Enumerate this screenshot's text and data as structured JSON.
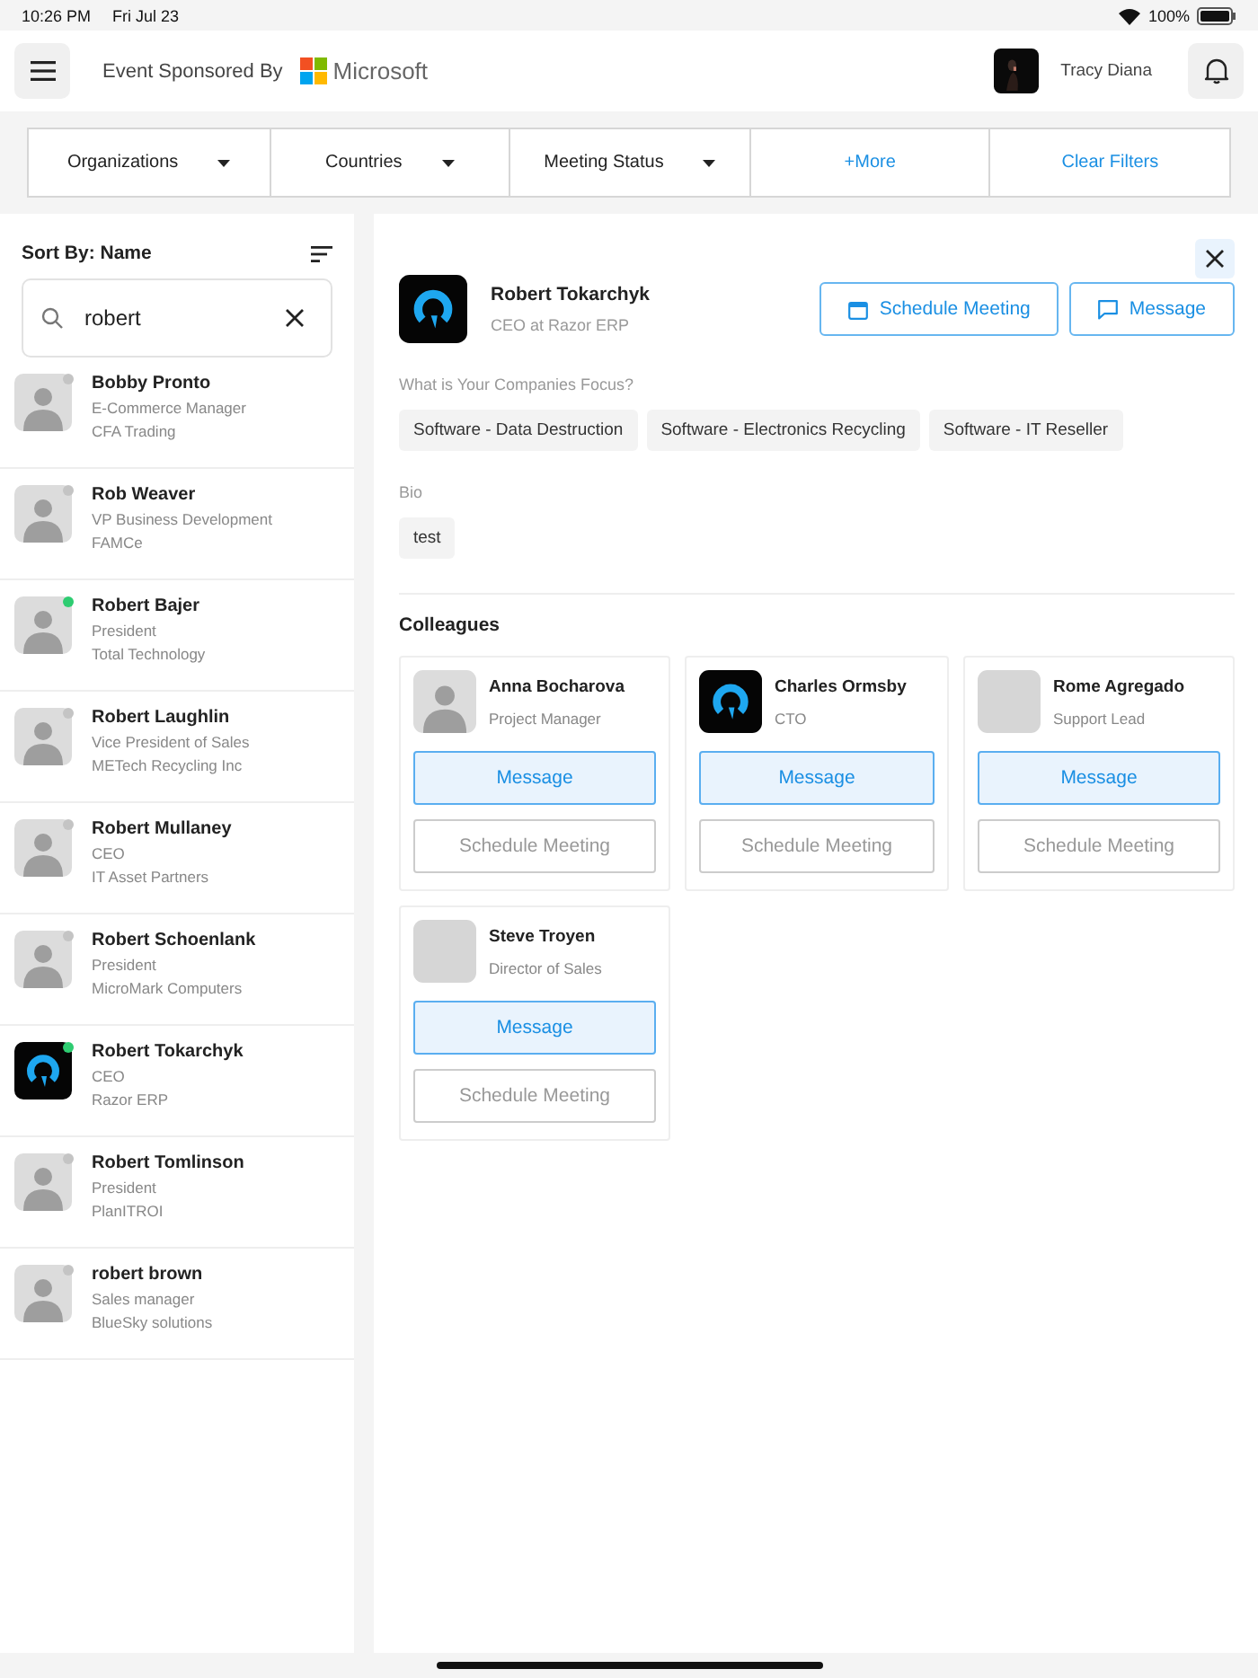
{
  "status_bar": {
    "time": "10:26 PM",
    "date": "Fri Jul 23",
    "battery": "100%"
  },
  "header": {
    "sponsor_label": "Event Sponsored By",
    "sponsor_name": "Microsoft",
    "user_name": "Tracy Diana"
  },
  "filters": [
    {
      "label": "Organizations",
      "kind": "dropdown"
    },
    {
      "label": "Countries",
      "kind": "dropdown"
    },
    {
      "label": "Meeting Status",
      "kind": "dropdown"
    },
    {
      "label": "+More",
      "kind": "link"
    },
    {
      "label": "Clear Filters",
      "kind": "link"
    }
  ],
  "sidebar": {
    "sort_label": "Sort By: Name",
    "search": {
      "value": "robert"
    },
    "people": [
      {
        "name": "Bobby Pronto",
        "title": "E-Commerce Manager",
        "company": "CFA Trading",
        "avatar": {
          "kind": "placeholder"
        },
        "online": false
      },
      {
        "name": "Rob Weaver",
        "title": "VP Business Development",
        "company": "FAMCe",
        "avatar": {
          "kind": "placeholder"
        },
        "online": false
      },
      {
        "name": "Robert Bajer",
        "title": "President",
        "company": "Total Technology",
        "avatar": {
          "kind": "placeholder"
        },
        "online": true
      },
      {
        "name": "Robert Laughlin",
        "title": "Vice President of Sales",
        "company": "METech Recycling Inc",
        "avatar": {
          "kind": "placeholder"
        },
        "online": false
      },
      {
        "name": "Robert Mullaney",
        "title": "CEO",
        "company": "IT Asset Partners",
        "avatar": {
          "kind": "placeholder"
        },
        "online": false
      },
      {
        "name": "Robert Schoenlank",
        "title": "President",
        "company": "MicroMark Computers",
        "avatar": {
          "kind": "placeholder"
        },
        "online": false
      },
      {
        "name": "Robert Tokarchyk",
        "title": "CEO",
        "company": "Razor ERP",
        "avatar": {
          "kind": "logo"
        },
        "online": true
      },
      {
        "name": "Robert Tomlinson",
        "title": "President",
        "company": "PlanITROI",
        "avatar": {
          "kind": "placeholder"
        },
        "online": false
      },
      {
        "name": "robert brown",
        "title": "Sales manager",
        "company": "BlueSky solutions",
        "avatar": {
          "kind": "placeholder"
        },
        "online": false
      }
    ]
  },
  "detail": {
    "name": "Robert Tokarchyk",
    "subtitle": "CEO at Razor ERP",
    "avatar": {
      "kind": "logo"
    },
    "actions": [
      {
        "label": "Schedule Meeting",
        "kind": "calendar"
      },
      {
        "label": "Message",
        "kind": "chat"
      }
    ],
    "focus_label": "What is Your Companies Focus?",
    "focus_tags": [
      "Software - Data Destruction",
      "Software - Electronics Recycling",
      "Software - IT Reseller"
    ],
    "bio_label": "Bio",
    "bio_tags": [
      "test"
    ],
    "colleagues_heading": "Colleagues",
    "colleagues": [
      {
        "name": "Anna Bocharova",
        "title": "Project Manager",
        "avatar": {
          "kind": "placeholder"
        },
        "message": "Message",
        "schedule": "Schedule Meeting"
      },
      {
        "name": "Charles Ormsby",
        "title": "CTO",
        "avatar": {
          "kind": "logo"
        },
        "message": "Message",
        "schedule": "Schedule Meeting"
      },
      {
        "name": "Rome Agregado",
        "title": "Support Lead",
        "avatar": {
          "kind": "blank"
        },
        "message": "Message",
        "schedule": "Schedule Meeting"
      },
      {
        "name": "Steve Troyen",
        "title": "Director of Sales",
        "avatar": {
          "kind": "blank"
        },
        "message": "Message",
        "schedule": "Schedule Meeting"
      }
    ]
  }
}
